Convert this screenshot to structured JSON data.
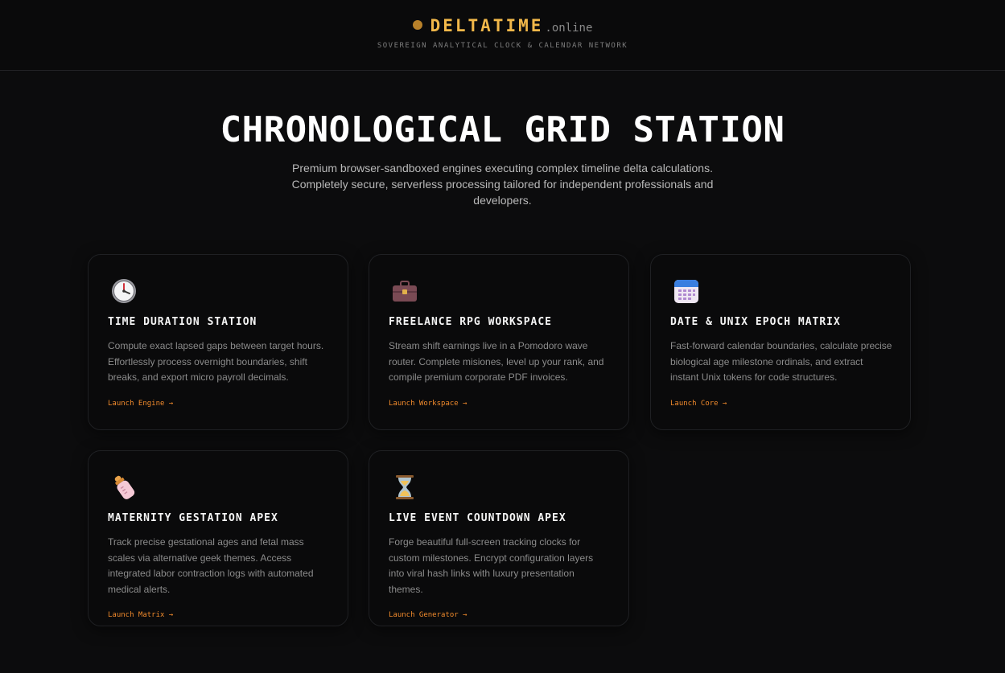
{
  "brand": {
    "name": "DELTATIME",
    "tld": ".online",
    "tagline": "SOVEREIGN ANALYTICAL CLOCK & CALENDAR NETWORK"
  },
  "hero": {
    "title": "CHRONOLOGICAL GRID STATION",
    "subtitle": "Premium browser-sandboxed engines executing complex timeline delta calculations. Completely secure, serverless processing tailored for independent professionals and developers."
  },
  "cards": [
    {
      "icon": "clock-icon",
      "title": "TIME DURATION STATION",
      "description": "Compute exact lapsed gaps between target hours. Effortlessly process overnight boundaries, shift breaks, and export micro payroll decimals.",
      "link": "Launch Engine →"
    },
    {
      "icon": "briefcase-icon",
      "title": "FREELANCE RPG WORKSPACE",
      "description": "Stream shift earnings live in a Pomodoro wave router. Complete misiones, level up your rank, and compile premium corporate PDF invoices.",
      "link": "Launch Workspace →"
    },
    {
      "icon": "calendar-icon",
      "title": "DATE & UNIX EPOCH MATRIX",
      "description": "Fast-forward calendar boundaries, calculate precise biological age milestone ordinals, and extract instant Unix tokens for code structures.",
      "link": "Launch Core →"
    },
    {
      "icon": "baby-bottle-icon",
      "title": "MATERNITY GESTATION APEX",
      "description": "Track precise gestational ages and fetal mass scales via alternative geek themes. Access integrated labor contraction logs with automated medical alerts.",
      "link": "Launch Matrix →"
    },
    {
      "icon": "hourglass-icon",
      "title": "LIVE EVENT COUNTDOWN APEX",
      "description": "Forge beautiful full-screen tracking clocks for custom milestones. Encrypt configuration layers into viral hash links with luxury presentation themes.",
      "link": "Launch Generator →"
    }
  ],
  "colors": {
    "accent": "#f08a2c",
    "brand": "#f2b84a",
    "background": "#0c0c0d"
  }
}
